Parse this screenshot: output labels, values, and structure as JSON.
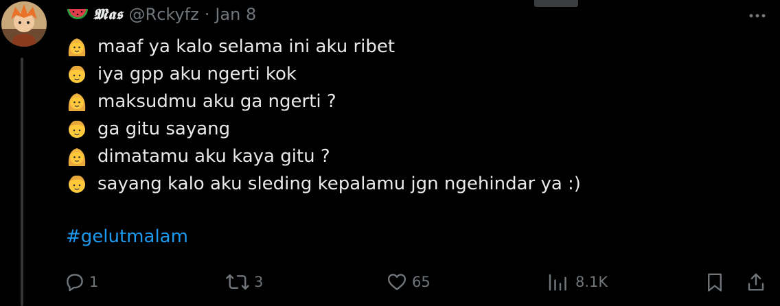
{
  "tweet": {
    "author": {
      "display_name": "𝕸𝖆𝖘",
      "handle": "@Rckyfz",
      "name_emoji": "watermelon-emoji"
    },
    "separator": "·",
    "date": "Jan 8",
    "lines": [
      {
        "speaker": "woman-emoji",
        "text": "maaf ya kalo selama ini aku ribet"
      },
      {
        "speaker": "boy-emoji",
        "text": "iya gpp aku ngerti kok"
      },
      {
        "speaker": "woman-emoji",
        "text": "maksudmu aku ga ngerti ?"
      },
      {
        "speaker": "boy-emoji",
        "text": "ga gitu sayang"
      },
      {
        "speaker": "woman-emoji",
        "text": "dimatamu aku kaya gitu ?"
      },
      {
        "speaker": "boy-emoji",
        "text": "sayang kalo aku sleding kepalamu jgn ngehindar ya :)"
      }
    ],
    "hashtag": "#gelutmalam",
    "actions": {
      "replies": "1",
      "retweets": "3",
      "likes": "65",
      "views": "8.1K"
    }
  },
  "colors": {
    "background": "#000000",
    "text": "#e7e9ea",
    "muted": "#71767b",
    "link": "#1d9bf0"
  }
}
